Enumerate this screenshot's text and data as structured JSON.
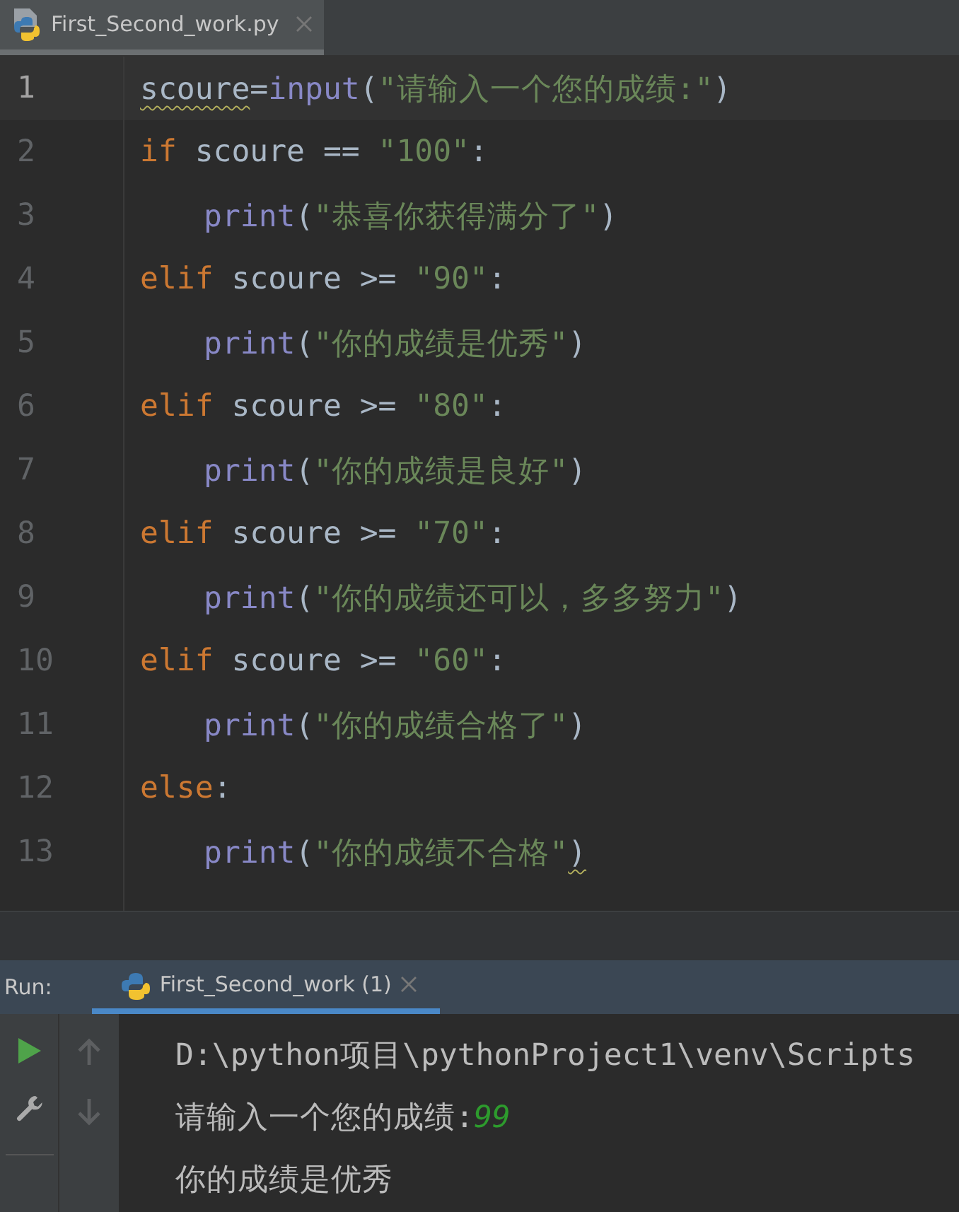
{
  "editor_tabs": [
    {
      "label": "First_Second_work.py",
      "selected": true
    }
  ],
  "code_lines": [
    {
      "number": "1",
      "selected": true,
      "tokens": [
        {
          "kind": "plain",
          "text": "scoure",
          "warning": true
        },
        {
          "kind": "plain",
          "text": "="
        },
        {
          "kind": "builtin",
          "text": "input"
        },
        {
          "kind": "plain",
          "text": "("
        },
        {
          "kind": "string",
          "text": "\"请输入一个您的成绩:\""
        },
        {
          "kind": "plain",
          "text": ")"
        }
      ]
    },
    {
      "number": "2",
      "selected": false,
      "tokens": [
        {
          "kind": "keyword",
          "text": "if"
        },
        {
          "kind": "plain",
          "text": " scoure == "
        },
        {
          "kind": "string",
          "text": "\"100\""
        },
        {
          "kind": "plain",
          "text": ":"
        }
      ]
    },
    {
      "number": "3",
      "selected": false,
      "indented": true,
      "tokens": [
        {
          "kind": "builtin",
          "text": "print"
        },
        {
          "kind": "plain",
          "text": "("
        },
        {
          "kind": "string",
          "text": "\"恭喜你获得满分了\""
        },
        {
          "kind": "plain",
          "text": ")"
        }
      ]
    },
    {
      "number": "4",
      "selected": false,
      "tokens": [
        {
          "kind": "keyword",
          "text": "elif"
        },
        {
          "kind": "plain",
          "text": " scoure >= "
        },
        {
          "kind": "string",
          "text": "\"90\""
        },
        {
          "kind": "plain",
          "text": ":"
        }
      ]
    },
    {
      "number": "5",
      "selected": false,
      "indented": true,
      "tokens": [
        {
          "kind": "builtin",
          "text": "print"
        },
        {
          "kind": "plain",
          "text": "("
        },
        {
          "kind": "string",
          "text": "\"你的成绩是优秀\""
        },
        {
          "kind": "plain",
          "text": ")"
        }
      ]
    },
    {
      "number": "6",
      "selected": false,
      "tokens": [
        {
          "kind": "keyword",
          "text": "elif"
        },
        {
          "kind": "plain",
          "text": " scoure >= "
        },
        {
          "kind": "string",
          "text": "\"80\""
        },
        {
          "kind": "plain",
          "text": ":"
        }
      ]
    },
    {
      "number": "7",
      "selected": false,
      "indented": true,
      "tokens": [
        {
          "kind": "builtin",
          "text": "print"
        },
        {
          "kind": "plain",
          "text": "("
        },
        {
          "kind": "string",
          "text": "\"你的成绩是良好\""
        },
        {
          "kind": "plain",
          "text": ")"
        }
      ]
    },
    {
      "number": "8",
      "selected": false,
      "tokens": [
        {
          "kind": "keyword",
          "text": "elif"
        },
        {
          "kind": "plain",
          "text": " scoure >= "
        },
        {
          "kind": "string",
          "text": "\"70\""
        },
        {
          "kind": "plain",
          "text": ":"
        }
      ]
    },
    {
      "number": "9",
      "selected": false,
      "indented": true,
      "tokens": [
        {
          "kind": "builtin",
          "text": "print"
        },
        {
          "kind": "plain",
          "text": "("
        },
        {
          "kind": "string",
          "text": "\"你的成绩还可以，多多努力\""
        },
        {
          "kind": "plain",
          "text": ")"
        }
      ]
    },
    {
      "number": "10",
      "selected": false,
      "tokens": [
        {
          "kind": "keyword",
          "text": "elif"
        },
        {
          "kind": "plain",
          "text": " scoure >= "
        },
        {
          "kind": "string",
          "text": "\"60\""
        },
        {
          "kind": "plain",
          "text": ":"
        }
      ]
    },
    {
      "number": "11",
      "selected": false,
      "indented": true,
      "tokens": [
        {
          "kind": "builtin",
          "text": "print"
        },
        {
          "kind": "plain",
          "text": "("
        },
        {
          "kind": "string",
          "text": "\"你的成绩合格了\""
        },
        {
          "kind": "plain",
          "text": ")"
        }
      ]
    },
    {
      "number": "12",
      "selected": false,
      "tokens": [
        {
          "kind": "keyword",
          "text": "else"
        },
        {
          "kind": "plain",
          "text": ":"
        }
      ]
    },
    {
      "number": "13",
      "selected": false,
      "indented": true,
      "tokens": [
        {
          "kind": "builtin",
          "text": "print"
        },
        {
          "kind": "plain",
          "text": "("
        },
        {
          "kind": "string",
          "text": "\"你的成绩不合格\""
        },
        {
          "kind": "plain",
          "text": ")",
          "warning": true
        }
      ]
    }
  ],
  "run_panel": {
    "label": "Run:",
    "tabs": [
      {
        "label": "First_Second_work (1)",
        "selected": true
      }
    ],
    "console_lines": [
      [
        {
          "kind": "output",
          "text": "D:\\python项目\\pythonProject1\\venv\\Scripts"
        }
      ],
      [
        {
          "kind": "output",
          "text": "请输入一个您的成绩:"
        },
        {
          "kind": "input",
          "text": "99"
        }
      ],
      [
        {
          "kind": "output",
          "text": "你的成绩是优秀"
        }
      ]
    ]
  }
}
